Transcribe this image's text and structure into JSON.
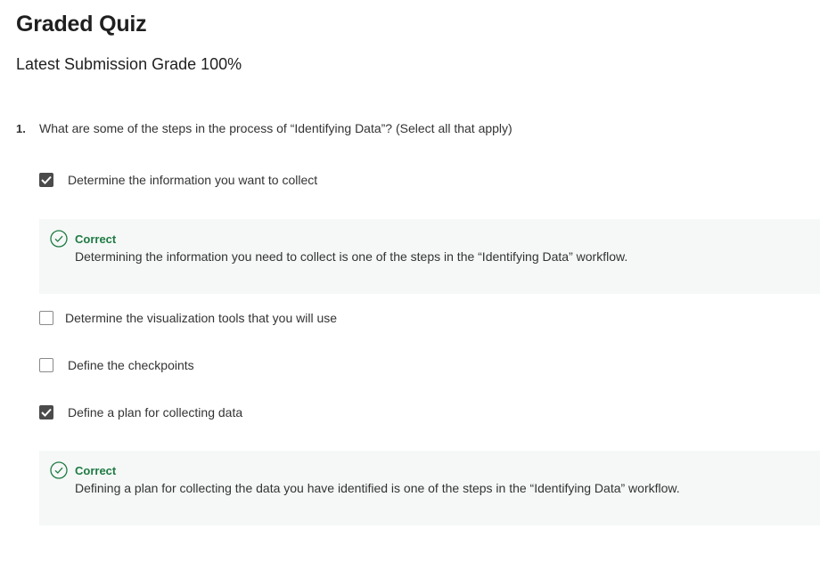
{
  "quiz": {
    "title": "Graded Quiz",
    "grade_line": "Latest Submission Grade 100%"
  },
  "question": {
    "number": "1.",
    "text": "What are some of the steps in the process of “Identifying Data”? (Select all that apply)",
    "options": [
      {
        "label": "Determine the information you want to collect",
        "checked": true
      },
      {
        "label": "Determine the visualization tools that you will use",
        "checked": false
      },
      {
        "label": "Define the checkpoints",
        "checked": false
      },
      {
        "label": "Define a plan for collecting data",
        "checked": true
      }
    ],
    "feedback": [
      {
        "status": "Correct",
        "text": "Determining the information you need to collect is one of the steps in the “Identifying Data” workflow."
      },
      {
        "status": "Correct",
        "text": "Defining a plan for collecting the data you have identified is one of the steps in the “Identifying Data” workflow."
      }
    ]
  },
  "icons": {
    "check": "checkmark-icon",
    "correct": "check-circle-icon"
  },
  "colors": {
    "correct_green": "#1f7a43",
    "checkbox_checked": "#4b4b4b",
    "feedback_bg": "#f5f8f7"
  }
}
